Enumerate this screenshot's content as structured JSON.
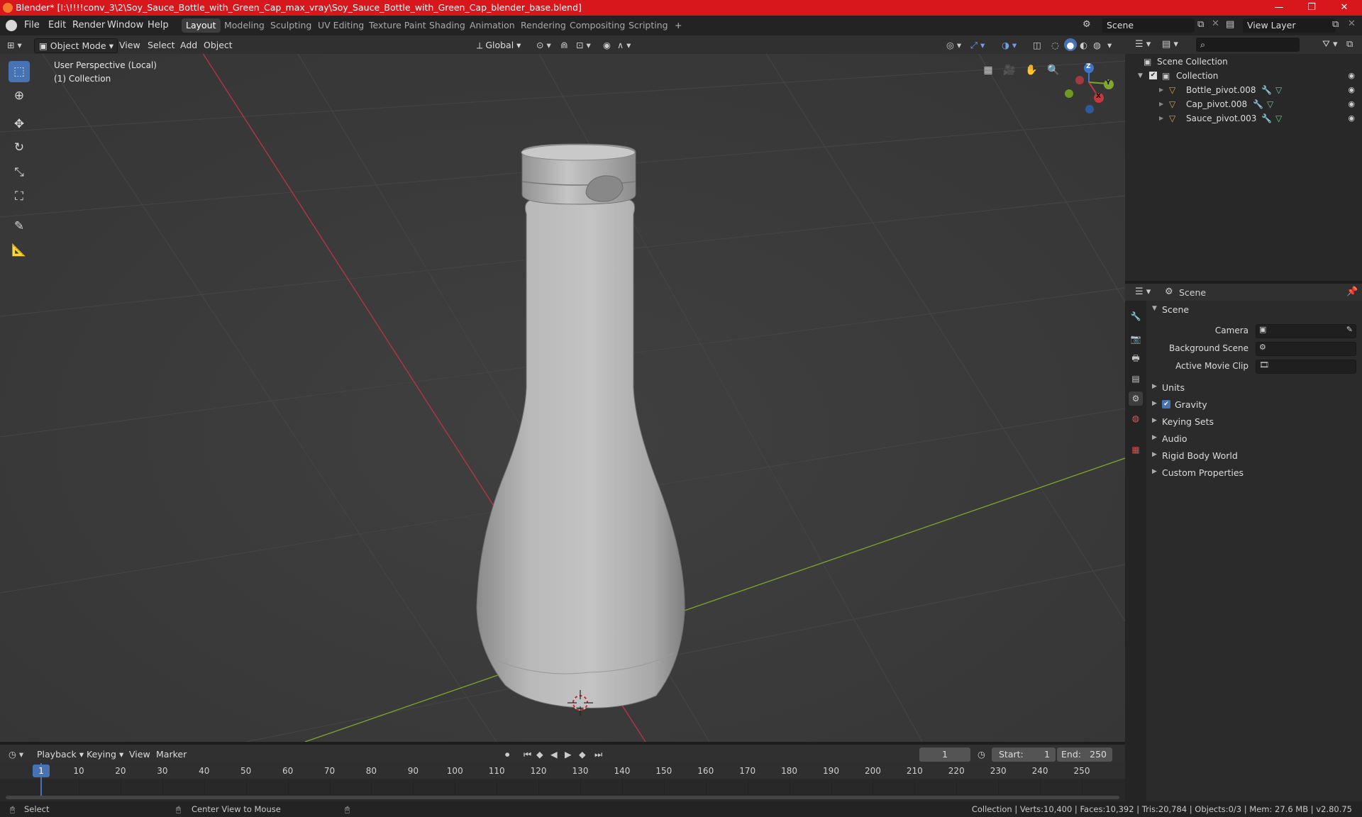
{
  "window": {
    "title": "Blender* [I:\\!!!!conv_3\\2\\Soy_Sauce_Bottle_with_Green_Cap_max_vray\\Soy_Sauce_Bottle_with_Green_Cap_blender_base.blend]",
    "min": "—",
    "max": "❐",
    "close": "✕"
  },
  "menu": [
    "File",
    "Edit",
    "Render",
    "Window",
    "Help"
  ],
  "workspaces": [
    "Layout",
    "Modeling",
    "Sculpting",
    "UV Editing",
    "Texture Paint",
    "Shading",
    "Animation",
    "Rendering",
    "Compositing",
    "Scripting"
  ],
  "workspace_add": "+",
  "scene_field": "Scene",
  "view_layer_field": "View Layer",
  "viewport_header": {
    "mode": "Object Mode",
    "menus": [
      "View",
      "Select",
      "Add",
      "Object"
    ],
    "orientation": "Global"
  },
  "viewport": {
    "perspective": "User Perspective (Local)",
    "collection": "(1) Collection",
    "gizmo": {
      "z": "Z",
      "y": "Y",
      "x": "X"
    }
  },
  "outliner": {
    "scene_collection": "Scene Collection",
    "collection": "Collection",
    "objects": [
      "Bottle_pivot.008",
      "Cap_pivot.008",
      "Sauce_pivot.003"
    ]
  },
  "properties": {
    "header": "Scene",
    "section": "Scene",
    "fields": [
      {
        "label": "Camera"
      },
      {
        "label": "Background Scene"
      },
      {
        "label": "Active Movie Clip"
      }
    ],
    "panels": [
      "Units",
      "Gravity",
      "Keying Sets",
      "Audio",
      "Rigid Body World",
      "Custom Properties"
    ]
  },
  "timeline": {
    "menus": [
      "Playback",
      "Keying",
      "View",
      "Marker"
    ],
    "current_frame": "1",
    "start_label": "Start:",
    "start": "1",
    "end_label": "End:",
    "end": "250",
    "ticks": [
      "1",
      "10",
      "20",
      "30",
      "40",
      "50",
      "60",
      "70",
      "80",
      "90",
      "100",
      "110",
      "120",
      "130",
      "140",
      "150",
      "160",
      "170",
      "180",
      "190",
      "200",
      "210",
      "220",
      "230",
      "240",
      "250"
    ]
  },
  "status": {
    "select": "Select",
    "center": "Center View to Mouse",
    "stats": "Collection | Verts:10,400 | Faces:10,392 | Tris:20,784 | Objects:0/3 | Mem: 27.6 MB | v2.80.75"
  },
  "colors": {
    "title_bar": "#d8171d",
    "accent": "#4772b3",
    "x_axis": "#b8383f",
    "y_axis": "#7da82c",
    "object_orange": "#e8a040",
    "mesh_green": "#5fd18a"
  }
}
